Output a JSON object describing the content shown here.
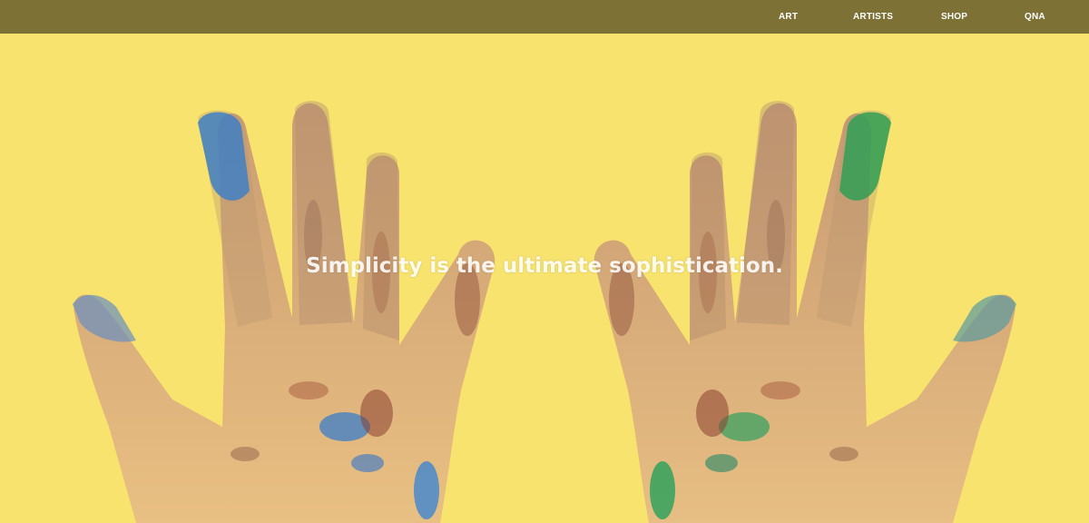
{
  "nav": {
    "items": [
      {
        "label": "ART"
      },
      {
        "label": "ARTISTS"
      },
      {
        "label": "SHOP"
      },
      {
        "label": "QNA"
      }
    ]
  },
  "hero": {
    "tagline": "Simplicity is the ultimate sophistication."
  },
  "colors": {
    "topbar": "#7d7136",
    "background": "#f7e36e",
    "nav_text": "#ffffff"
  }
}
